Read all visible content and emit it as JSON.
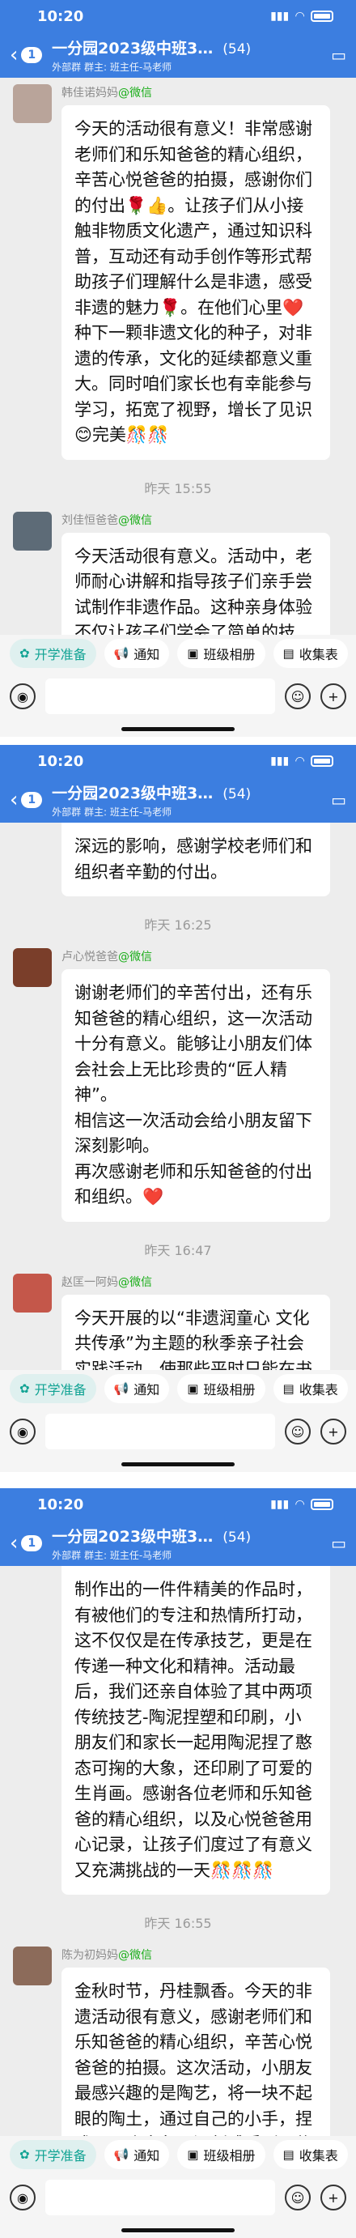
{
  "status": {
    "time": "10:20",
    "signal": "▮▮▮",
    "wifi": "◠"
  },
  "header": {
    "back_badge_count": "1",
    "title": "一分园2023级中班3…",
    "member_count": "(54)",
    "subtitle": "外部群 · 群主: 班主任-马老师",
    "subtitle_short": "外部群  群主: 班主任-马老师"
  },
  "quickbar": {
    "item1": "开学准备",
    "item2": "通知",
    "item3": "班级相册",
    "item4": "收集表"
  },
  "colors": {
    "brand_blue": "#3c7ee0",
    "wechat_green": "#1aad19",
    "teal": "#12a394"
  },
  "panel0": {
    "msg1": {
      "sender": "韩佳诺妈妈",
      "wx_tag": "@微信",
      "text": "今天的活动很有意义！非常感谢老师们和乐知爸爸的精心组织，辛苦心悦爸爸的拍摄，感谢你们的付出🌹👍。让孩子们从小接触非物质文化遗产，通过知识科普，互动还有动手创作等形式帮助孩子们理解什么是非遗，感受非遗的魅力🌹。在他们心里❤️种下一颗非遗文化的种子，对非遗的传承，文化的延续都意义重大。同时咱们家长也有幸能参与学习，拓宽了视野，增长了见识😊完美🎊🎊"
    },
    "time": "昨天 15:55",
    "msg2": {
      "sender": "刘佳恒爸爸",
      "wx_tag": "@微信",
      "text": "今天活动很有意义。活动中，老师耐心讲解和指导孩子们亲手尝试制作非遗作品。这种亲身体验不仅让孩子们学会了简单的技艺，更重要的是让他们体会到了“匠人精神”——专注、耐"
    }
  },
  "panel1": {
    "msg_top": {
      "text": "深远的影响，感谢学校老师们和组织者辛勤的付出。"
    },
    "time1": "昨天 16:25",
    "msg1": {
      "sender": "卢心悦爸爸",
      "wx_tag": "@微信",
      "text": "谢谢老师们的辛苦付出，还有乐知爸爸的精心组织，这一次活动十分有意义。能够让小朋友们体会社会上无比珍贵的“匠人精神”。\n相信这一次活动会给小朋友留下深刻影响。\n再次感谢老师和乐知爸爸的付出和组织。❤️"
    },
    "time2": "昨天 16:47",
    "msg2": {
      "sender": "赵匡一阿妈",
      "wx_tag": "@微信",
      "text": "今天开展的以“非遗润童心 文化共传承”为主题的秋季亲子社会实践活动，使那些平时只能在书本上看到的非物质文化遗产鲜活地展现在我们眼前，让我们深切感受到祖先们的智慧和创造力。特别看到那些手工艺人用心"
    }
  },
  "panel2": {
    "msg_top": {
      "text": "制作出的一件件精美的作品时，有被他们的专注和热情所打动，这不仅仅是在传承技艺，更是在传递一种文化和精神。活动最后，我们还亲自体验了其中两项传统技艺-陶泥捏塑和印刷，小朋友们和家长一起用陶泥捏了憨态可掬的大象，还印刷了可爱的生肖画。感谢各位老师和乐知爸爸的精心组织，以及心悦爸爸用心记录，让孩子们度过了有意义又充满挑战的一天🎊🎊🎊"
    },
    "time1": "昨天 16:55",
    "msg1": {
      "sender": "陈为初妈妈",
      "wx_tag": "@微信",
      "text": "金秋时节，丹桂飘香。今天的非遗活动很有意义，感谢老师们和乐知爸爸的精心组织，辛苦心悦爸爸的拍摄。这次活动，小朋友最感兴趣的是陶艺，将一块不起眼的陶土，通过自己的小手，捏成了一头大象，深刻感受到了传统技艺的独特魅力。"
    }
  }
}
